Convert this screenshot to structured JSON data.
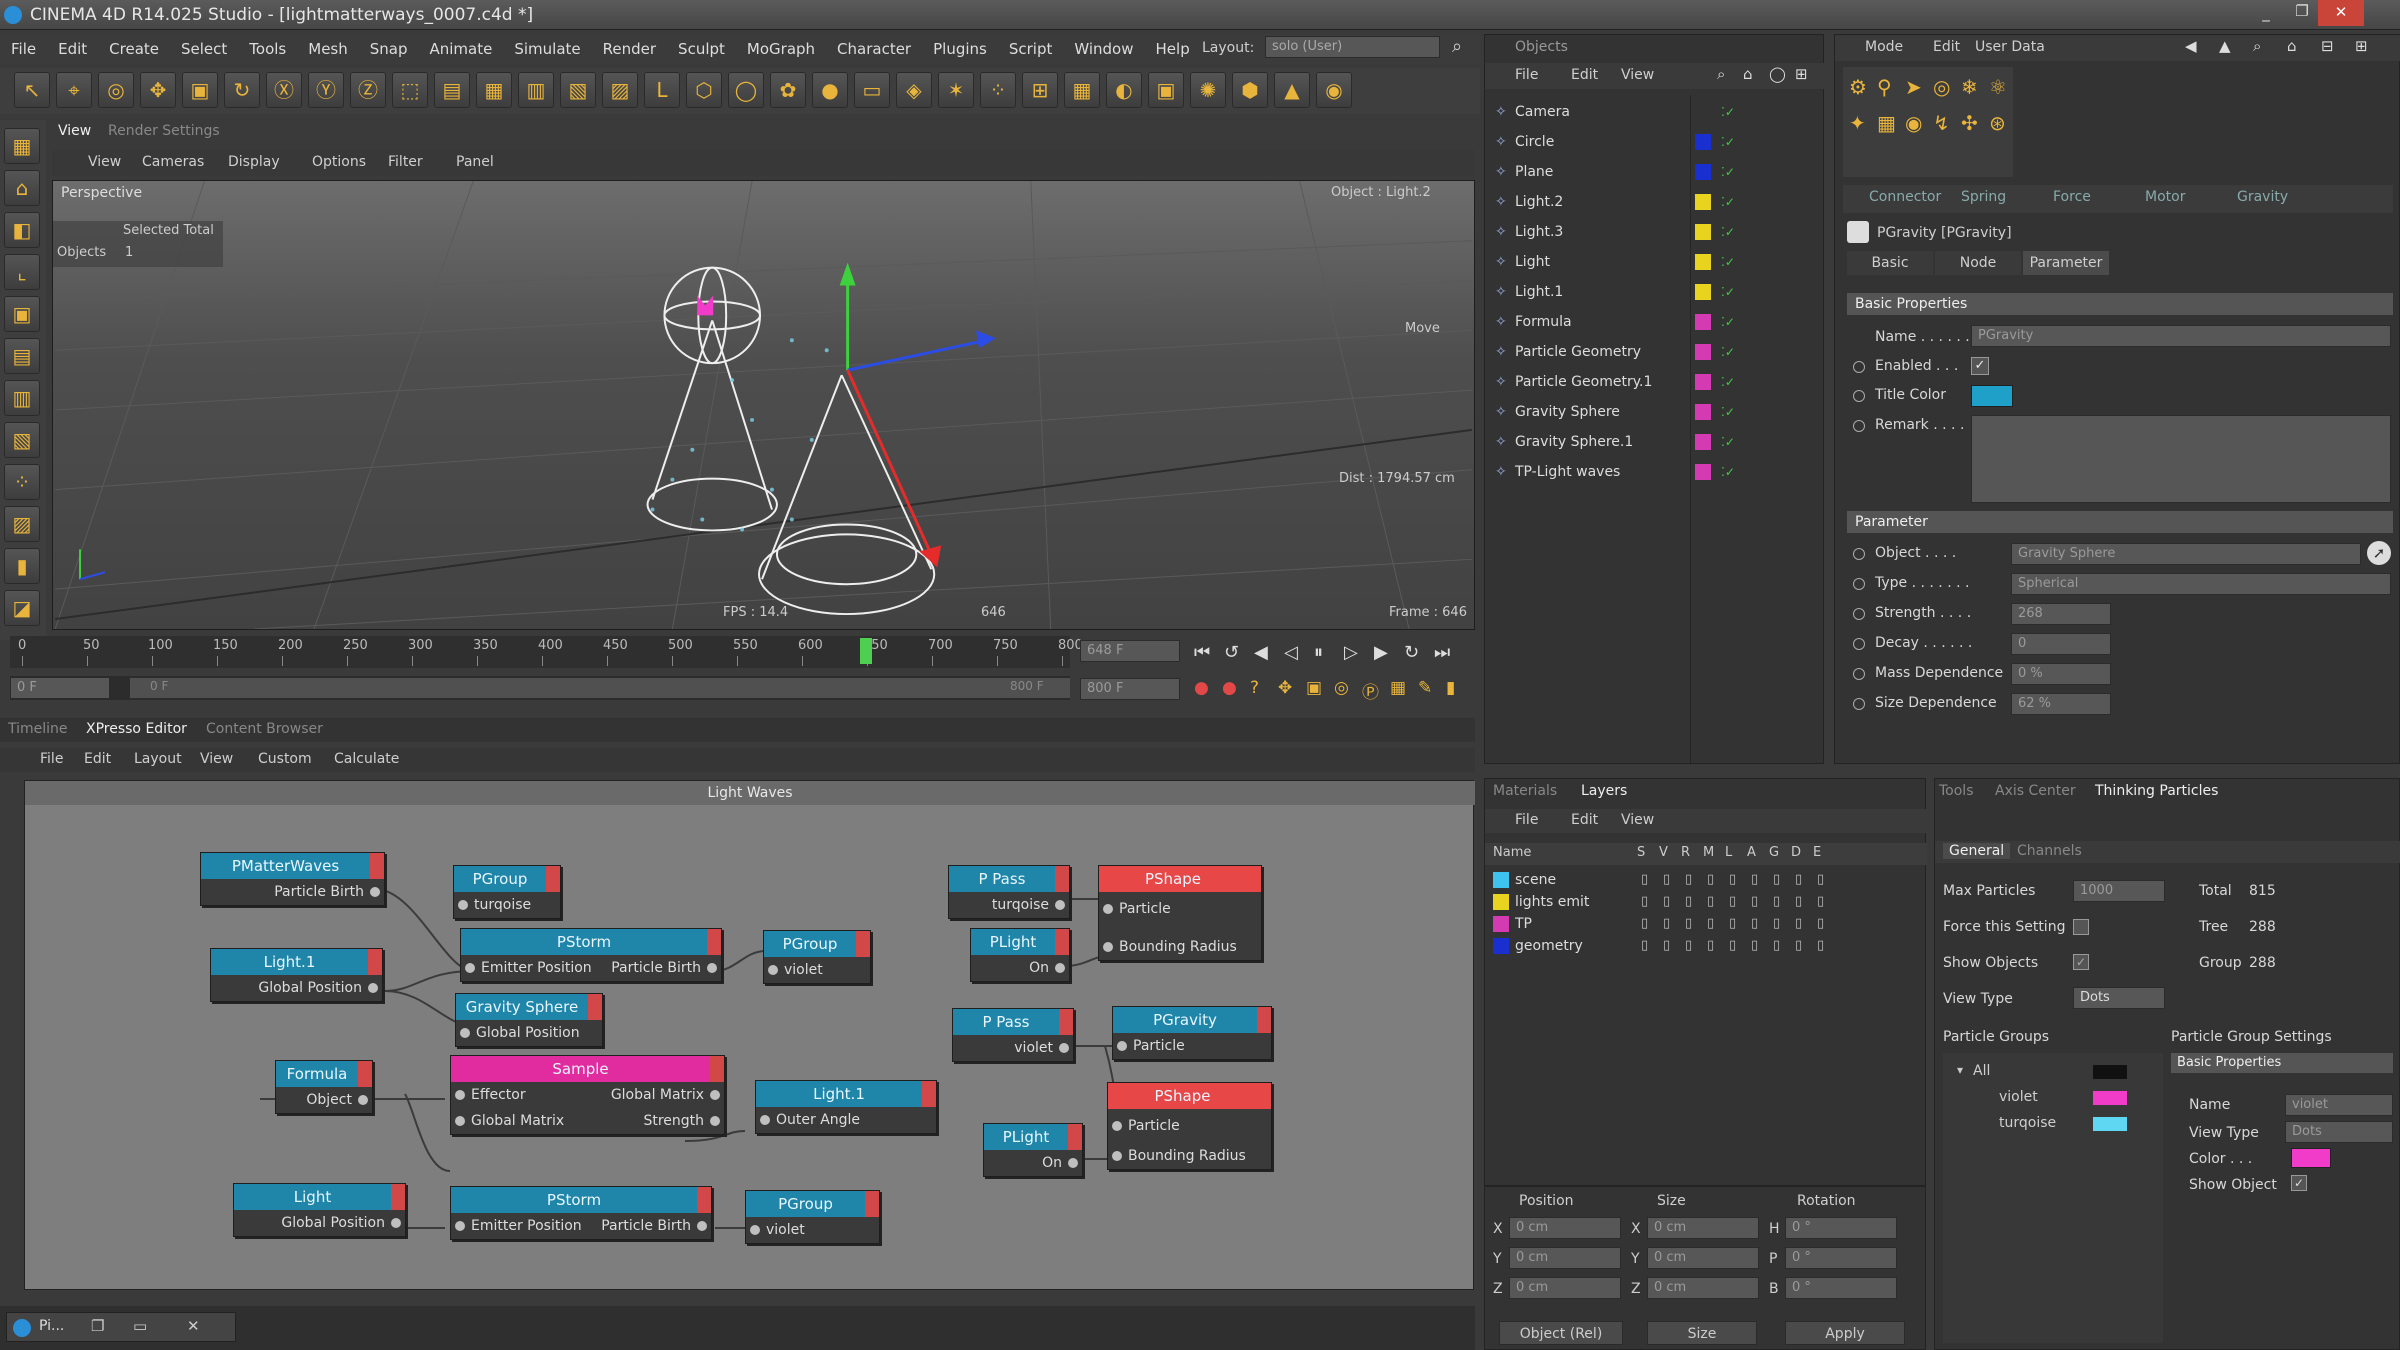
{
  "window": {
    "title": "CINEMA 4D R14.025 Studio - [lightmatterways_0007.c4d *]"
  },
  "menu": [
    "File",
    "Edit",
    "Create",
    "Select",
    "Tools",
    "Mesh",
    "Snap",
    "Animate",
    "Simulate",
    "Render",
    "Sculpt",
    "MoGraph",
    "Character",
    "Plugins",
    "Script",
    "Window",
    "Help"
  ],
  "layout": {
    "label": "Layout:",
    "value": "solo (User)"
  },
  "viewport": {
    "tabs": [
      "View",
      "Render Settings"
    ],
    "menu": [
      "View",
      "Cameras",
      "Display",
      "Options",
      "Filter",
      "Panel"
    ],
    "name": "Perspective",
    "hud_header": "Selected Total",
    "hud_objects_label": "Objects",
    "hud_objects_value": "1",
    "object_label": "Object : Light.2",
    "move_label": "Move",
    "dist": "Dist : 1794.57 cm",
    "fps": "FPS : 14.4",
    "frame_mid": "646",
    "frame": "Frame : 646"
  },
  "timeline": {
    "ticks": [
      "0",
      "50",
      "100",
      "150",
      "200",
      "250",
      "300",
      "350",
      "400",
      "450",
      "500",
      "550",
      "600",
      "650",
      "700",
      "750",
      "800"
    ],
    "current": "648 F",
    "end": "800 F",
    "start": "0 F",
    "range_start": "0 F",
    "range_end": "800 F",
    "playhead": 0.81
  },
  "bottom_tabs": [
    "Timeline",
    "XPresso Editor",
    "Content Browser"
  ],
  "xpresso": {
    "menu": [
      "File",
      "Edit",
      "Layout",
      "View",
      "Custom",
      "Calculate"
    ],
    "title": "Light Waves",
    "nodes": {
      "pmatter": {
        "title": "PMatterWaves",
        "out": "Particle Birth"
      },
      "pgroup1": {
        "title": "PGroup",
        "out": "turqoise"
      },
      "pstorm1": {
        "title": "PStorm",
        "in": "Emitter Position",
        "out": "Particle Birth"
      },
      "pgroup2": {
        "title": "PGroup",
        "out": "violet"
      },
      "light1": {
        "title": "Light.1",
        "out": "Global Position"
      },
      "gravsphere": {
        "title": "Gravity Sphere",
        "out": "Global Position"
      },
      "formula": {
        "title": "Formula",
        "out": "Object"
      },
      "sample": {
        "title": "Sample",
        "in1": "Effector",
        "out1": "Global Matrix",
        "in2": "Global Matrix",
        "out2": "Strength"
      },
      "light1b": {
        "title": "Light.1",
        "in": "Outer Angle"
      },
      "light": {
        "title": "Light",
        "out": "Global Position"
      },
      "pstorm2": {
        "title": "PStorm",
        "in": "Emitter Position",
        "out": "Particle Birth"
      },
      "pgroup3": {
        "title": "PGroup",
        "out": "violet"
      },
      "ppass1": {
        "title": "P Pass",
        "out": "turqoise"
      },
      "plight1": {
        "title": "PLight",
        "out": "On"
      },
      "pshape1": {
        "title": "PShape",
        "in1": "Particle",
        "in2": "Bounding Radius"
      },
      "ppass2": {
        "title": "P Pass",
        "out": "violet"
      },
      "pgravity": {
        "title": "PGravity",
        "in": "Particle"
      },
      "plight2": {
        "title": "PLight",
        "out": "On"
      },
      "pshape2": {
        "title": "PShape",
        "in1": "Particle",
        "in2": "Bounding Radius"
      }
    }
  },
  "objects": {
    "title": "Objects",
    "menu": [
      "File",
      "Edit",
      "View"
    ],
    "items": [
      {
        "name": "Camera",
        "color": ""
      },
      {
        "name": "Circle",
        "color": "#1a2fd0"
      },
      {
        "name": "Plane",
        "color": "#1a2fd0"
      },
      {
        "name": "Light.2",
        "color": "#e8d41e"
      },
      {
        "name": "Light.3",
        "color": "#e8d41e"
      },
      {
        "name": "Light",
        "color": "#e8d41e"
      },
      {
        "name": "Light.1",
        "color": "#e8d41e"
      },
      {
        "name": "Formula",
        "color": "#d43ab2"
      },
      {
        "name": "Particle Geometry",
        "color": "#d43ab2"
      },
      {
        "name": "Particle Geometry.1",
        "color": "#d43ab2"
      },
      {
        "name": "Gravity Sphere",
        "color": "#d43ab2"
      },
      {
        "name": "Gravity Sphere.1",
        "color": "#d43ab2"
      },
      {
        "name": "TP-Light waves",
        "color": "#d43ab2"
      }
    ]
  },
  "attributes": {
    "menu": [
      "Mode",
      "Edit",
      "User Data"
    ],
    "tabs": [
      "Connector",
      "Spring",
      "Force",
      "Motor",
      "Gravity"
    ],
    "header": "PGravity [PGravity]",
    "subtabs": [
      "Basic",
      "Node",
      "Parameter"
    ],
    "basic_section": "Basic Properties",
    "name_label": "Name . . . . . .",
    "name_value": "PGravity",
    "enabled_label": "Enabled . . .",
    "titlecolor_label": "Title Color",
    "remark_label": "Remark . . . .",
    "param_section": "Parameter",
    "object_label": "Object . . . .",
    "object_value": "Gravity Sphere",
    "type_label": "Type . . . . . . .",
    "type_value": "Spherical",
    "strength_label": "Strength . . . .",
    "strength_value": "268",
    "decay_label": "Decay . . . . . .",
    "decay_value": "0",
    "mass_label": "Mass Dependence",
    "mass_value": "0 %",
    "size_label": "Size Dependence",
    "size_value": "62 %",
    "title_color": "#1ea0c8"
  },
  "layers": {
    "tabs": [
      "Materials",
      "Layers"
    ],
    "menu": [
      "File",
      "Edit",
      "View"
    ],
    "cols": [
      "Name",
      "S",
      "V",
      "R",
      "M",
      "L",
      "A",
      "G",
      "D",
      "E"
    ],
    "items": [
      {
        "name": "scene",
        "color": "#3ec3ef"
      },
      {
        "name": "lights emit",
        "color": "#e8d41e"
      },
      {
        "name": "TP",
        "color": "#d43ab2"
      },
      {
        "name": "geometry",
        "color": "#1a2fd0"
      }
    ]
  },
  "coords": {
    "heads": [
      "Position",
      "Size",
      "Rotation"
    ],
    "rows": [
      {
        "a": "X",
        "v1": "0 cm",
        "b": "X",
        "v2": "0 cm",
        "c": "H",
        "v3": "0 °"
      },
      {
        "a": "Y",
        "v1": "0 cm",
        "b": "Y",
        "v2": "0 cm",
        "c": "P",
        "v3": "0 °"
      },
      {
        "a": "Z",
        "v1": "0 cm",
        "b": "Z",
        "v2": "0 cm",
        "c": "B",
        "v3": "0 °"
      }
    ],
    "mode1": "Object (Rel)",
    "mode2": "Size",
    "apply": "Apply"
  },
  "tp": {
    "tabs": [
      "Tools",
      "Axis Center",
      "Thinking Particles"
    ],
    "subtabs": [
      "General",
      "Channels"
    ],
    "max_label": "Max Particles",
    "max_value": "1000",
    "total_label": "Total",
    "total_value": "815",
    "tree_label": "Tree",
    "tree_value": "288",
    "group_label": "Group",
    "group_value": "288",
    "force_label": "Force this Setting",
    "show_label": "Show Objects",
    "viewtype_label": "View Type",
    "viewtype_value": "Dots",
    "groups_title": "Particle Groups",
    "groups": [
      {
        "name": "All",
        "color": "#111111"
      },
      {
        "name": "violet",
        "color": "#f03cc8"
      },
      {
        "name": "turqoise",
        "color": "#5fd6f2"
      }
    ],
    "settings_title": "Particle Group Settings",
    "settings_section": "Basic Properties",
    "s_name_label": "Name",
    "s_name_value": "violet",
    "s_view_label": "View Type",
    "s_view_value": "Dots",
    "s_color_label": "Color . . .",
    "s_color": "#f03cc8",
    "s_show_label": "Show Object"
  },
  "taskbar": {
    "app": "Pi..."
  }
}
